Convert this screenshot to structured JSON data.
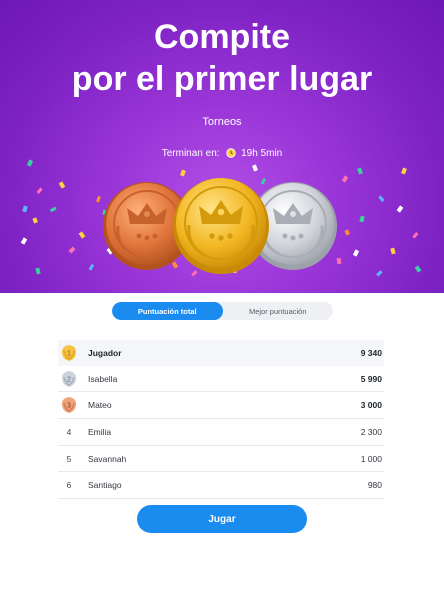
{
  "hero": {
    "title_line1": "Compite",
    "title_line2": "por el primer lugar",
    "subtitle": "Torneos",
    "timer_label": "Terminan en:",
    "timer_value": "19h 5min"
  },
  "tabs": [
    {
      "label": "Puntuación total",
      "active": true
    },
    {
      "label": "Mejor puntuación",
      "active": false
    }
  ],
  "leaderboard": [
    {
      "rank": "1",
      "name": "Jugador",
      "score": "9 340"
    },
    {
      "rank": "2",
      "name": "Isabella",
      "score": "5 990"
    },
    {
      "rank": "3",
      "name": "Mateo",
      "score": "3 000"
    },
    {
      "rank": "4",
      "name": "Emilia",
      "score": "2 300"
    },
    {
      "rank": "5",
      "name": "Savannah",
      "score": "1 000"
    },
    {
      "rank": "6",
      "name": "Santiago",
      "score": "980"
    }
  ],
  "play_button": "Jugar",
  "colors": {
    "accent": "#1a8bef",
    "hero": "#8a2ccf",
    "gold": "#f0b323",
    "silver": "#c9ccd3",
    "bronze": "#e0814a"
  },
  "icons": [
    "clock-icon",
    "crown-icon",
    "laurel-icon",
    "medal-badge-icon"
  ]
}
